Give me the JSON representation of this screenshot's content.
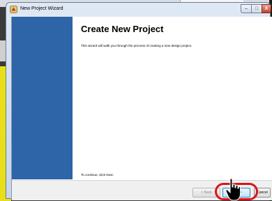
{
  "window": {
    "title": "New Project Wizard",
    "controls": {
      "minimize": "–",
      "maximize": "□",
      "close": "X"
    }
  },
  "main": {
    "heading": "Create New Project",
    "description": "This wizard will walk you through the process of creating a new design project.",
    "continue_text": "To continue, click Next."
  },
  "footer": {
    "back_label": "< Back",
    "next_label": "Next >",
    "cancel_label": "Cancel"
  },
  "colors": {
    "side_panel": "#2e64a8",
    "highlight": "#d9151c"
  },
  "icons": [
    "app-icon",
    "mouse-pointer-icon"
  ]
}
